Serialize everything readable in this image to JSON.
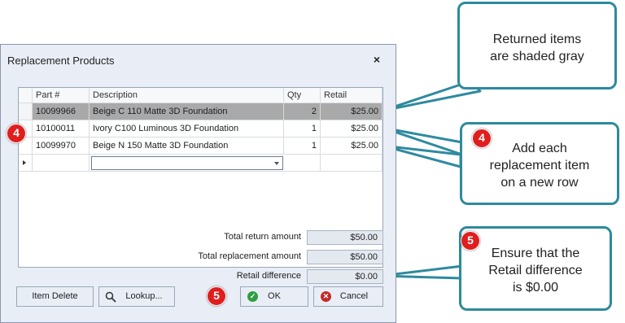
{
  "dialog": {
    "title": "Replacement Products",
    "close_glyph": "×",
    "columns": [
      "Part #",
      "Description",
      "Qty",
      "Retail"
    ],
    "rows": [
      {
        "part": "10099966",
        "description": "Beige C 110 Matte 3D Foundation",
        "qty": "2",
        "retail": "$25.00",
        "returned": true
      },
      {
        "part": "10100011",
        "description": "Ivory C100 Luminous 3D Foundation",
        "qty": "1",
        "retail": "$25.00",
        "returned": false
      },
      {
        "part": "10099970",
        "description": "Beige N 150 Matte 3D Foundation",
        "qty": "1",
        "retail": "$25.00",
        "returned": false
      }
    ],
    "totals": {
      "return_label": "Total return amount",
      "return_value": "$50.00",
      "replacement_label": "Total replacement amount",
      "replacement_value": "$50.00",
      "difference_label": "Retail difference",
      "difference_value": "$0.00"
    },
    "buttons": {
      "item_delete": "Item Delete",
      "lookup": "Lookup...",
      "ok": "OK",
      "cancel": "Cancel"
    }
  },
  "annotations": {
    "callout_returned": {
      "line1": "Returned items",
      "line2": "are shaded gray"
    },
    "callout_add": {
      "badge": "4",
      "line1": "Add each",
      "line2": "replacement item",
      "line3": "on a new row"
    },
    "callout_ensure": {
      "badge": "5",
      "line1": "Ensure that the",
      "line2": "Retail difference",
      "line3": "is $0.00"
    },
    "badge_grid": "4",
    "badge_ok": "5"
  },
  "colors": {
    "callout_border": "#2e8a9e",
    "badge_red": "#e01e1e",
    "returned_row_gray": "#a9a9a9"
  },
  "icons": {
    "close": "close-icon",
    "lookup": "search-icon",
    "ok": "check-circle-icon",
    "cancel": "x-circle-icon",
    "row_indicator": "caret-right-icon",
    "dropdown": "chevron-down-icon"
  }
}
